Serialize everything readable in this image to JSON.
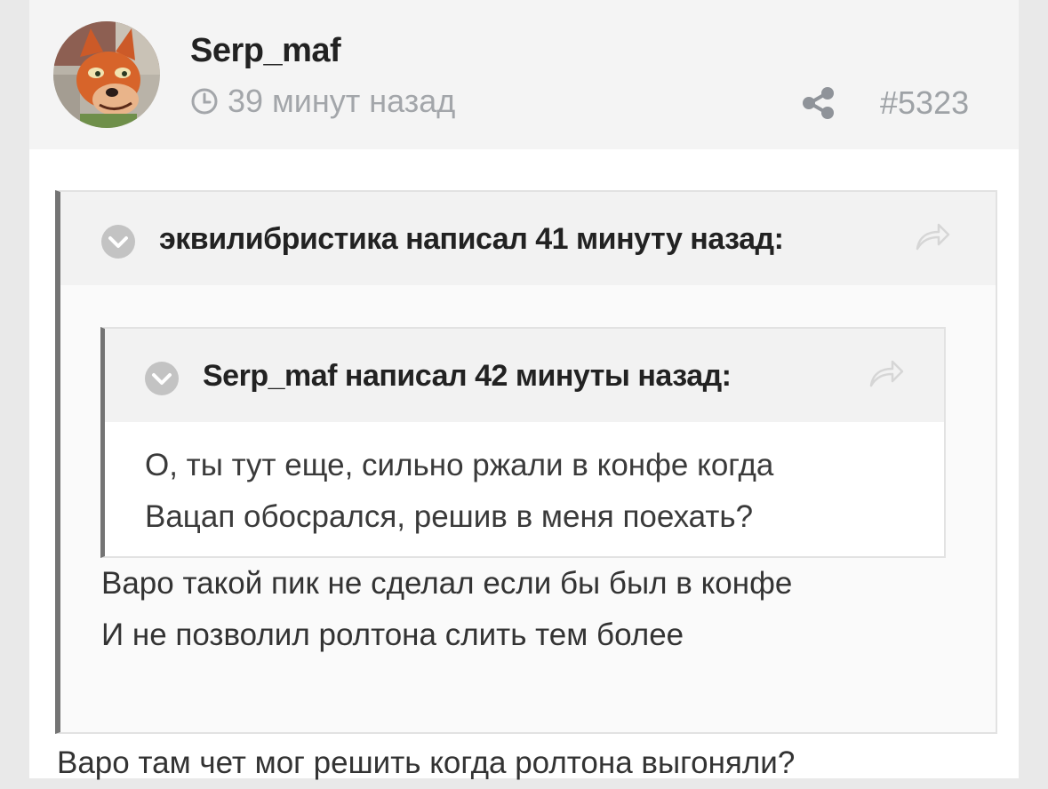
{
  "post": {
    "author": "Serp_maf",
    "time": "39 минут назад",
    "number": "#5323",
    "icons": {
      "avatar": "fox-avatar",
      "clock": "clock-icon",
      "share": "share-icon"
    }
  },
  "quote_outer": {
    "header": "эквилибристика написал 41 минуту назад:",
    "lines": [
      "Варо такой пик не сделал если бы был в конфе",
      "И не позволил ролтона слить тем более"
    ]
  },
  "quote_inner": {
    "header": "Serp_maf написал 42 минуты назад:",
    "lines": [
      "О, ты тут еще, сильно ржали в конфе когда",
      "Вацап обосрался, решив в меня поехать?"
    ]
  },
  "post_body": {
    "line": "Варо там чет мог решить когда ролтона выгоняли?"
  },
  "colors": {
    "header_bg": "#f4f4f4",
    "quote_border": "#747474",
    "muted_text": "#a3a6aa"
  }
}
